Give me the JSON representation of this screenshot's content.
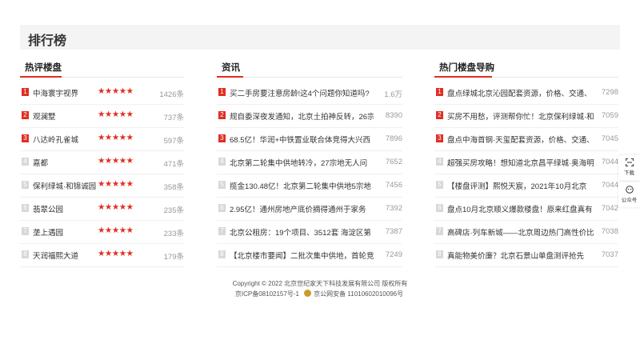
{
  "page_title": "排行榜",
  "columns": [
    {
      "title": "热评楼盘",
      "rows": [
        {
          "rank": "1",
          "name": "中海寰宇视界",
          "stars": "★★★★★",
          "count": "1426条"
        },
        {
          "rank": "2",
          "name": "观澜墅",
          "stars": "★★★★★",
          "count": "737条"
        },
        {
          "rank": "3",
          "name": "八达岭孔雀城",
          "stars": "★★★★★",
          "count": "597条"
        },
        {
          "rank": "4",
          "name": "嘉都",
          "stars": "★★★★★",
          "count": "471条"
        },
        {
          "rank": "5",
          "name": "保利绿城·和锦诚园",
          "stars": "★★★★★",
          "count": "358条"
        },
        {
          "rank": "6",
          "name": "翡翠公园",
          "stars": "★★★★★",
          "count": "235条"
        },
        {
          "rank": "7",
          "name": "垄上遇园",
          "stars": "★★★★★",
          "count": "233条"
        },
        {
          "rank": "8",
          "name": "天润福熙大道",
          "stars": "★★★★★",
          "count": "179条"
        }
      ]
    },
    {
      "title": "资讯",
      "rows": [
        {
          "rank": "1",
          "name": "买二手房要注意房龄!这4个问题你知道吗?",
          "count": "1.6万"
        },
        {
          "rank": "2",
          "name": "规自委深夜发通知，北京土拍神反转，26宗",
          "count": "8390"
        },
        {
          "rank": "3",
          "name": "68.5亿！华润+中铁置业联合体竞得大兴西",
          "count": "7896"
        },
        {
          "rank": "4",
          "name": "北京第二轮集中供地转冷，27宗地无人问",
          "count": "7652"
        },
        {
          "rank": "5",
          "name": "揽金130.48亿！北京第二轮集中供地5宗地",
          "count": "7456"
        },
        {
          "rank": "6",
          "name": "2.95亿！通州房地产底价摘得通州于家务",
          "count": "7392"
        },
        {
          "rank": "7",
          "name": "北京公租房：19个项目、3512套 海淀区第",
          "count": "7387"
        },
        {
          "rank": "8",
          "name": "【北京楼市要闻】二批次集中供地，首轮竞",
          "count": "7249"
        }
      ]
    },
    {
      "title": "热门楼盘导购",
      "rows": [
        {
          "rank": "1",
          "name": "盘点绿城北京沁园配套资源，价格、交通、",
          "count": "7298"
        },
        {
          "rank": "2",
          "name": "买房不用愁，评测帮你忙！北京保利绿城·和",
          "count": "7059"
        },
        {
          "rank": "3",
          "name": "盘点中海首钢·天玺配套资源，价格、交通、",
          "count": "7045"
        },
        {
          "rank": "4",
          "name": "超强买房攻略！想知道北京昌平绿城·奥海明",
          "count": "7044"
        },
        {
          "rank": "5",
          "name": "【楼盘评测】熙悦天宸，2021年10月北京",
          "count": "7044"
        },
        {
          "rank": "6",
          "name": "盘点10月北京顺义爆款楼盘！原来红盘真有",
          "count": "7042"
        },
        {
          "rank": "7",
          "name": "高碑店·列车新城——北京周边热门高性价比",
          "count": "7038"
        },
        {
          "rank": "8",
          "name": "真能物美价廉？北京石景山单盘测评抢先",
          "count": "7037"
        }
      ]
    }
  ],
  "footer": {
    "copyright": "Copyright © 2022 北京世纪家天下科技发展有限公司  版权所有",
    "icp": "京ICP备08102157号-1",
    "police": "京公网安备 11010602010096号"
  },
  "sidebar": {
    "download_label": "下载",
    "wechat_label": "公众号"
  },
  "colors": {
    "accent": "#e02e24",
    "header_bg": "#f4f4f4"
  }
}
